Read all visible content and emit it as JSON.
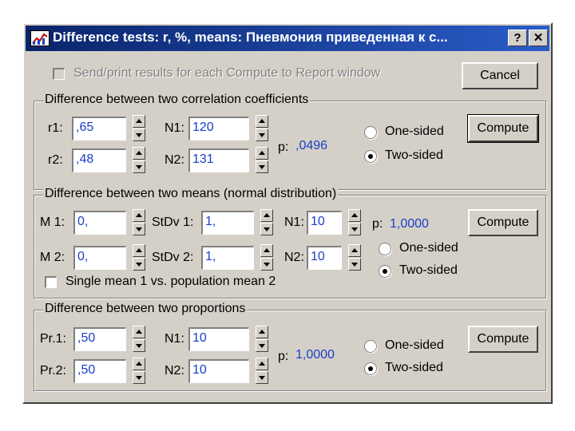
{
  "window": {
    "title": "Difference tests: r, %, means: Пневмония приведенная к с...",
    "help_label": "?",
    "close_label": "✕"
  },
  "top": {
    "send_label": "Send/print results for each Compute to Report window",
    "cancel_label": "Cancel"
  },
  "corr": {
    "title": "Difference between two correlation coefficients",
    "r1_label": "r1:",
    "r1_value": ",65",
    "r2_label": "r2:",
    "r2_value": ",48",
    "n1_label": "N1:",
    "n1_value": "120",
    "n2_label": "N2:",
    "n2_value": "131",
    "p_label": "p:",
    "p_value": ",0496",
    "one_sided": "One-sided",
    "two_sided": "Two-sided",
    "compute_label": "Compute"
  },
  "means": {
    "title": "Difference between two means (normal distribution)",
    "m1_label": "M 1:",
    "m1_value": "0,",
    "m2_label": "M 2:",
    "m2_value": "0,",
    "sd1_label": "StDv 1:",
    "sd1_value": "1,",
    "sd2_label": "StDv 2:",
    "sd2_value": "1,",
    "n1_label": "N1:",
    "n1_value": "10",
    "n2_label": "N2:",
    "n2_value": "10",
    "p_label": "p:",
    "p_value": "1,0000",
    "single_mean_label": "Single mean 1 vs. population mean 2",
    "one_sided": "One-sided",
    "two_sided": "Two-sided",
    "compute_label": "Compute"
  },
  "props": {
    "title": "Difference between two proportions",
    "p1_label": "Pr.1:",
    "p1_value": ",50",
    "p2_label": "Pr.2:",
    "p2_value": ",50",
    "n1_label": "N1:",
    "n1_value": "10",
    "n2_label": "N2:",
    "n2_value": "10",
    "p_label": "p:",
    "p_value": "1,0000",
    "one_sided": "One-sided",
    "two_sided": "Two-sided",
    "compute_label": "Compute"
  },
  "colors": {
    "titlebar": "#0a246a",
    "dialog_face": "#d4d0c8",
    "value_text": "#1a3ec8"
  }
}
